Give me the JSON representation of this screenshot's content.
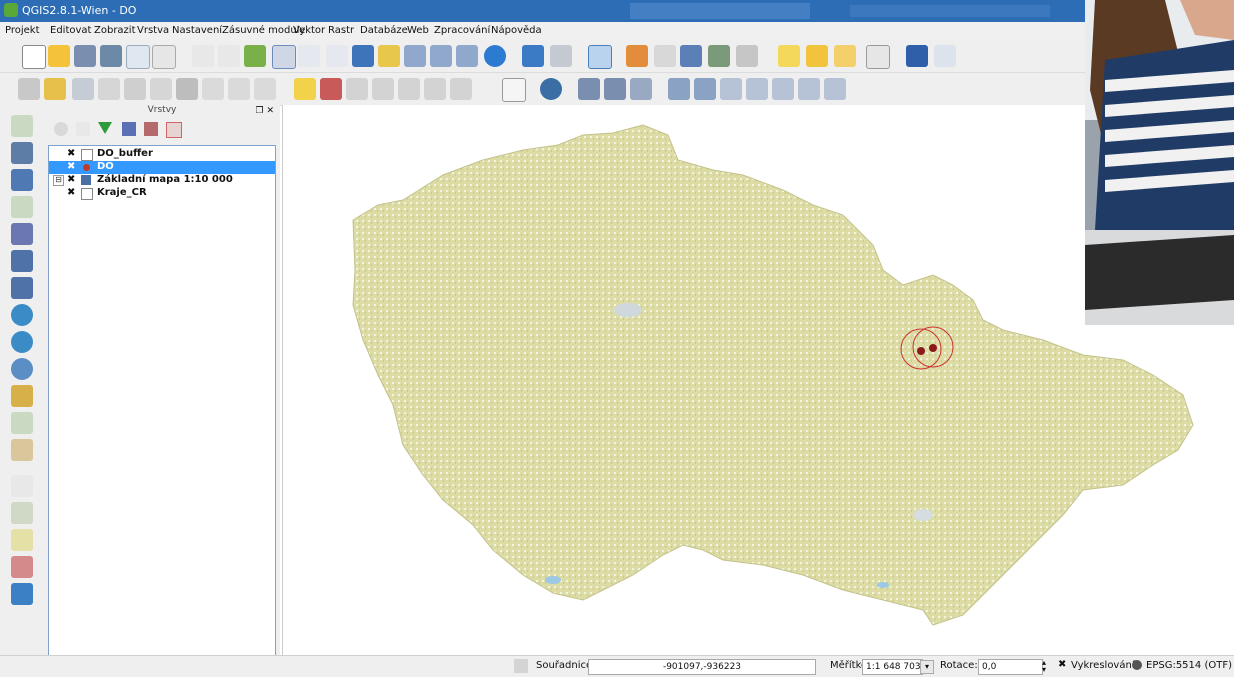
{
  "window": {
    "title": "QGIS2.8.1-Wien - DO"
  },
  "menu": [
    "Projekt",
    "Editovat",
    "Zobrazit",
    "Vrstva",
    "Nastavení",
    "Zásuvné moduly",
    "Vektor",
    "Rastr",
    "Databáze",
    "Web",
    "Zpracování",
    "Nápověda"
  ],
  "layers_panel": {
    "title": "Vrstvy",
    "layers": [
      {
        "name": "DO_buffer",
        "checked": "✖",
        "selected": false
      },
      {
        "name": "DO",
        "checked": "✖",
        "selected": true
      },
      {
        "name": "Základní mapa 1:10 000",
        "checked": "✖",
        "selected": false,
        "expander": "⊟"
      },
      {
        "name": "Kraje_CR",
        "checked": "✖",
        "selected": false
      }
    ]
  },
  "statusbar": {
    "coord_label": "Souřadnice:",
    "coord_value": "-901097,-936223",
    "scale_label": "Měřítko",
    "scale_value": "1:1 648 703",
    "rotation_label": "Rotace:",
    "rotation_value": "0,0",
    "render_label": "Vykreslování",
    "crs": "EPSG:5514 (OTF)"
  },
  "colors": {
    "titlebar": "#2c6db5",
    "map_fill": "#d9d9a0",
    "buffer": "#cc3333",
    "point": "#8b1a1a",
    "selection": "#3399ff"
  }
}
